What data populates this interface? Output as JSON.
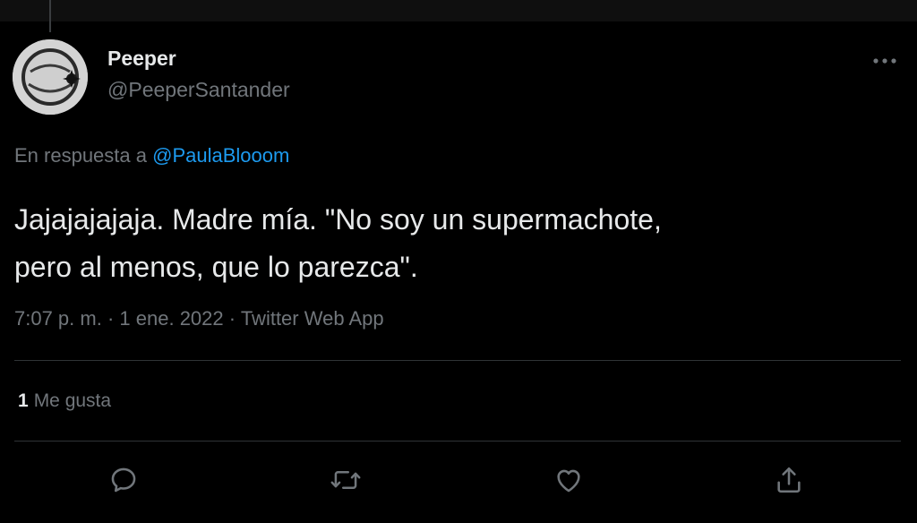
{
  "author": {
    "display_name": "Peeper",
    "handle": "@PeeperSantander"
  },
  "reply": {
    "prefix": "En respuesta a",
    "mention": "@PaulaBlooom"
  },
  "tweet": {
    "line1": "Jajajajajaja. Madre mía. \"No soy un supermachote,",
    "line2": "pero al menos, que lo parezca\"."
  },
  "meta": {
    "time": "7:07 p. m.",
    "separator": "·",
    "date": "1 ene. 2022",
    "source": "Twitter Web App"
  },
  "likes": {
    "count": "1",
    "label": "Me gusta"
  },
  "actions": [
    "reply-icon",
    "retweet-icon",
    "like-icon",
    "share-icon"
  ],
  "colors": {
    "background": "#000000",
    "text": "#e7e9ea",
    "secondary": "#71767b",
    "accent": "#1d9bf0",
    "divider": "#2f3336"
  }
}
